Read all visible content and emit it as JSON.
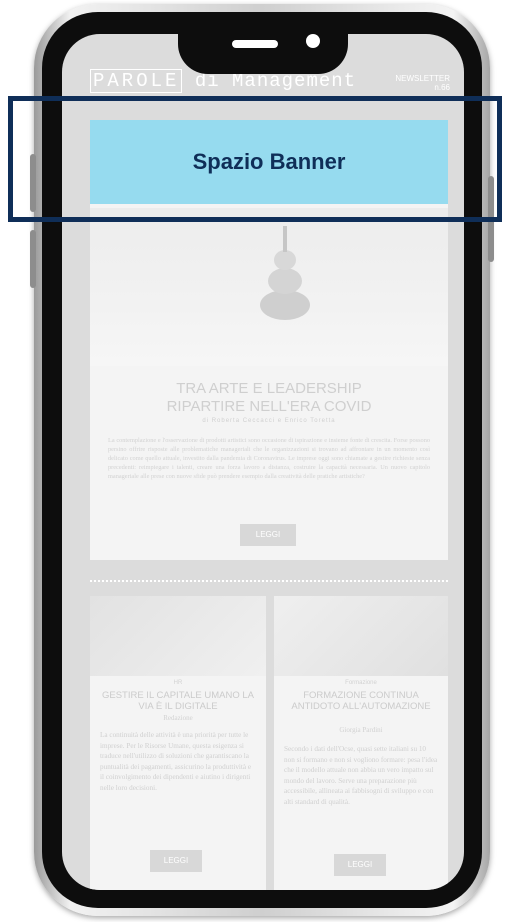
{
  "header": {
    "logo_boxed": "PAROLE",
    "logo_rest": "di Management",
    "newsletter_label": "NEWSLETTER",
    "issue": "n.66"
  },
  "banner": {
    "label": "Spazio Banner"
  },
  "main_article": {
    "title_line1": "TRA ARTE E LEADERSHIP",
    "title_line2": "RIPARTIRE NELL'ERA COVID",
    "author": "di Roberta Ceccacci e Enrico Toretta",
    "body": "La contemplazione e l'osservazione di prodotti artistici sono occasione di ispirazione e insieme fonte di crescita. Forse possono persino offrire risposte alle problematiche manageriali che le organizzazioni si trovano ad affrontare in un momento così delicato come quello attuale, investito dalla pandemia di Coronavirus. Le imprese oggi sono chiamate a gestire richieste senza precedenti: reimpiegare i talenti, creare una forza lavoro a distanza, costruire la capacità necessaria. Un nuovo capitolo manageriale alle prese con nuove sfide può prendere esempio dalla creatività delle pratiche artistiche?",
    "button": "LEGGI"
  },
  "card_left": {
    "tag": "HR",
    "title": "GESTIRE IL CAPITALE UMANO LA VIA È IL DIGITALE",
    "author": "Redazione",
    "body": "La continuità delle attività è una priorità per tutte le imprese. Per le Risorse Umane, questa esigenza si traduce nell'utilizzo di soluzioni che garantiscano la puntualità dei pagamenti, assicurino la produttività e il coinvolgimento dei dipendenti e aiutino i dirigenti nelle loro decisioni.",
    "button": "LEGGI"
  },
  "card_right": {
    "tag": "Formazione",
    "title": "FORMAZIONE CONTINUA ANTIDOTO ALL'AUTOMAZIONE",
    "author": "Giorgia Pardini",
    "body": "Secondo i dati dell'Ocse, quasi sette italiani su 10 non si formano e non si vogliono formare: pesa l'idea che il modello attuale non abbia un vero impatto sul mondo del lavoro. Serve una preparazione più accessibile, allineata ai fabbisogni di sviluppo e con alti standard di qualità.",
    "button": "LEGGI"
  }
}
